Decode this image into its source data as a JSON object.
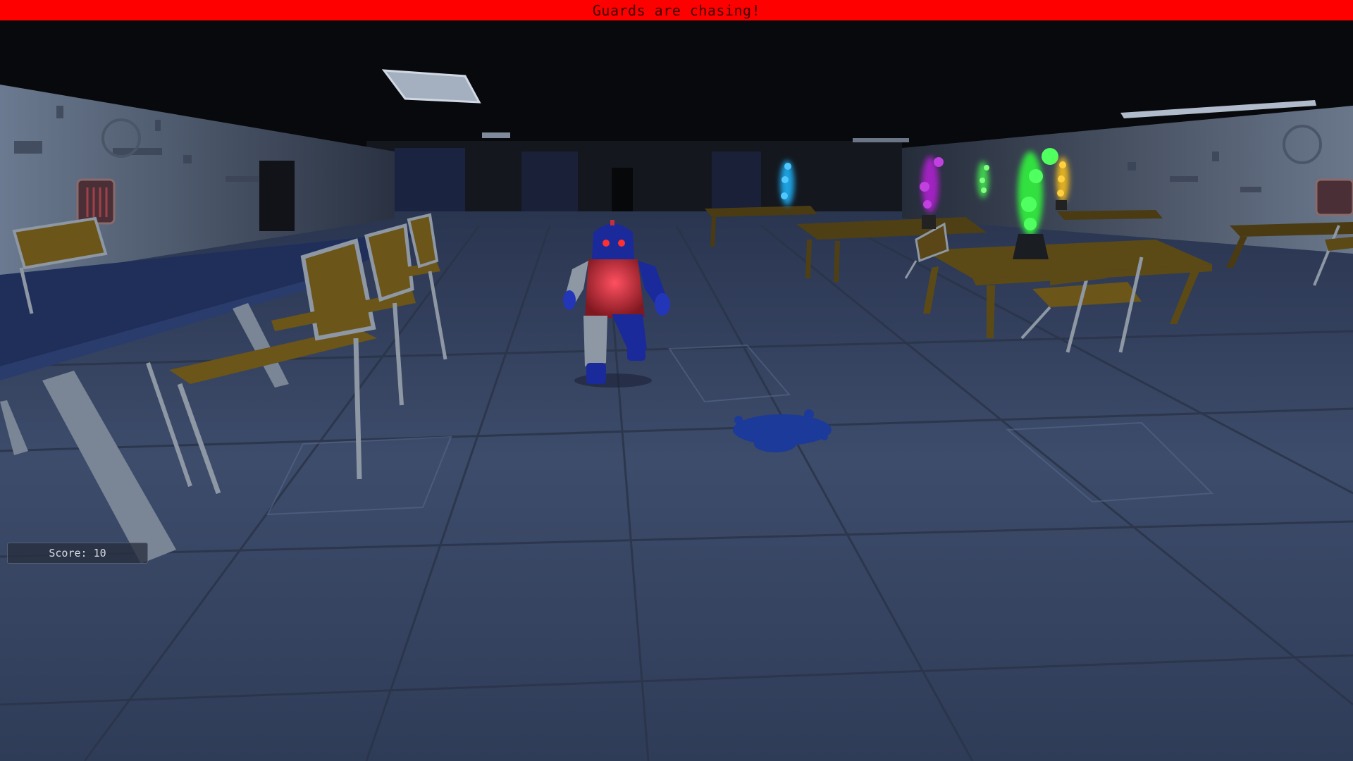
{
  "hud": {
    "alert_message": "Guards are chasing!",
    "score_label": "Score:",
    "score_value": 10
  },
  "colors": {
    "alert_bar": "#ff0000",
    "alert_text": "#3a0000",
    "score_text": "#d8dde5",
    "floor": "#3d4c6b",
    "ceiling": "#0a0b0e",
    "wall": "#5d6b80",
    "table_top_blue": "#1f2f5a",
    "table_top_brown": "#5c4a16",
    "chair_seat": "#6b5518",
    "chair_frame": "#8e97a4",
    "guard_body": "#1a2a9a",
    "guard_chest": "#c8303a",
    "puddle": "#1b3a9a"
  },
  "scene": {
    "character": "guard-robot",
    "lava_lamps": [
      "#1fa0e0",
      "#a020c0",
      "#40d050",
      "#30e040",
      "#e0b020"
    ]
  }
}
